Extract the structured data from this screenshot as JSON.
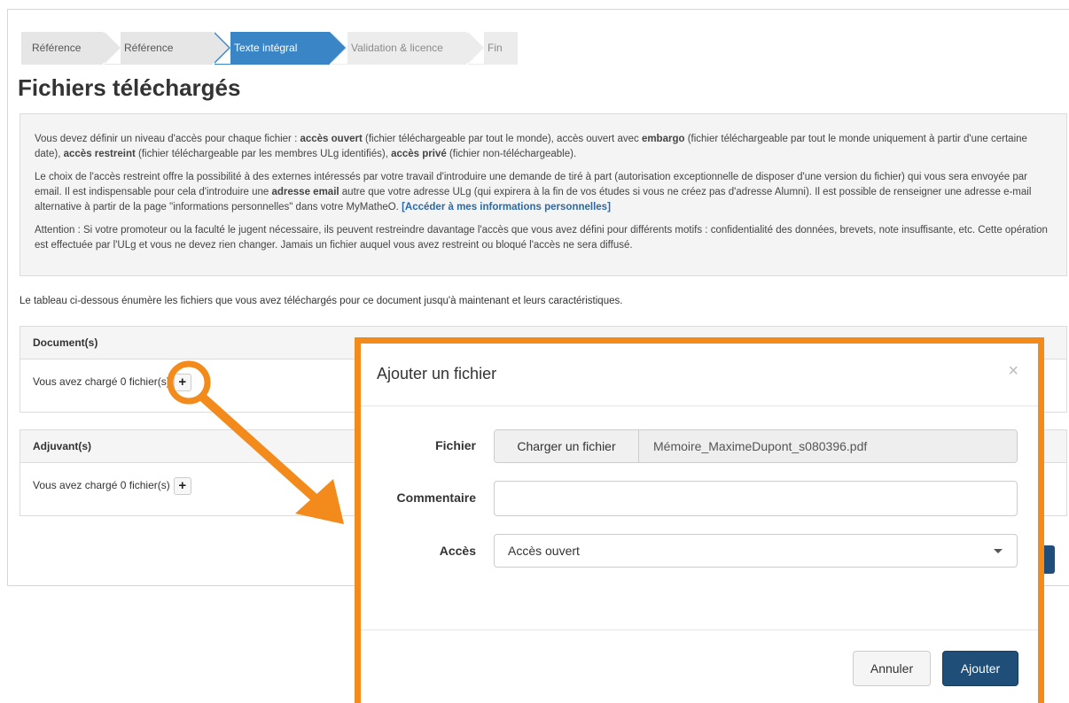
{
  "steps": [
    "Référence",
    "Référence",
    "Texte intégral",
    "Validation & licence",
    "Fin"
  ],
  "page_title": "Fichiers téléchargés",
  "info": {
    "p1_a": "Vous devez définir un niveau d'accès pour chaque fichier : ",
    "p1_b": "accès ouvert",
    "p1_c": " (fichier téléchargeable par tout le monde), accès ouvert avec ",
    "p1_d": "embargo",
    "p1_e": " (fichier téléchargeable par tout le monde uniquement à partir d'une certaine date), ",
    "p1_f": "accès restreint",
    "p1_g": " (fichier téléchargeable par les membres ULg identifiés), ",
    "p1_h": "accès privé",
    "p1_i": " (fichier non-téléchargeable).",
    "p2_a": "Le choix de l'accès restreint offre la possibilité à des externes intéressés par votre travail d'introduire une demande de tiré à part (autorisation exceptionnelle de disposer d'une version du fichier) qui vous sera envoyée par email. Il est indispensable pour cela d'introduire une ",
    "p2_b": "adresse email",
    "p2_c": " autre que votre adresse ULg (qui expirera à la fin de vos études si vous ne créez pas d'adresse Alumni). Il est possible de renseigner une adresse e-mail alternative à partir de la page \"informations personnelles\" dans votre MyMatheO. ",
    "p2_link": "[Accéder à mes informations personnelles]",
    "p3": "Attention : Si votre promoteur ou la faculté le jugent nécessaire, ils peuvent restreindre davantage l'accès que vous avez défini pour différents motifs : confidentialité des données, brevets, note insuffisante, etc. Cette opération est effectuée par l'ULg et vous ne devez rien changer. Jamais un fichier auquel vous avez restreint ou bloqué l'accès ne sera diffusé."
  },
  "lead": "Le tableau ci-dessous énumère les fichiers que vous avez téléchargés pour ce document jusqu'à maintenant et leurs caractéristiques.",
  "panels": [
    {
      "title": "Document(s)",
      "text": "Vous avez chargé 0 fichier(s)",
      "add": "+"
    },
    {
      "title": "Adjuvant(s)",
      "text": "Vous avez chargé 0 fichier(s)",
      "add": "+"
    }
  ],
  "modal": {
    "title": "Ajouter un fichier",
    "close": "×",
    "file_label": "Fichier",
    "file_button": "Charger un fichier",
    "file_name": "Mémoire_MaximeDupont_s080396.pdf",
    "comment_label": "Commentaire",
    "access_label": "Accès",
    "access_value": "Accès ouvert",
    "cancel": "Annuler",
    "submit": "Ajouter"
  },
  "colors": {
    "accent": "#3a85c6",
    "annotation": "#f28a1c",
    "primary_button": "#1f4e78"
  }
}
